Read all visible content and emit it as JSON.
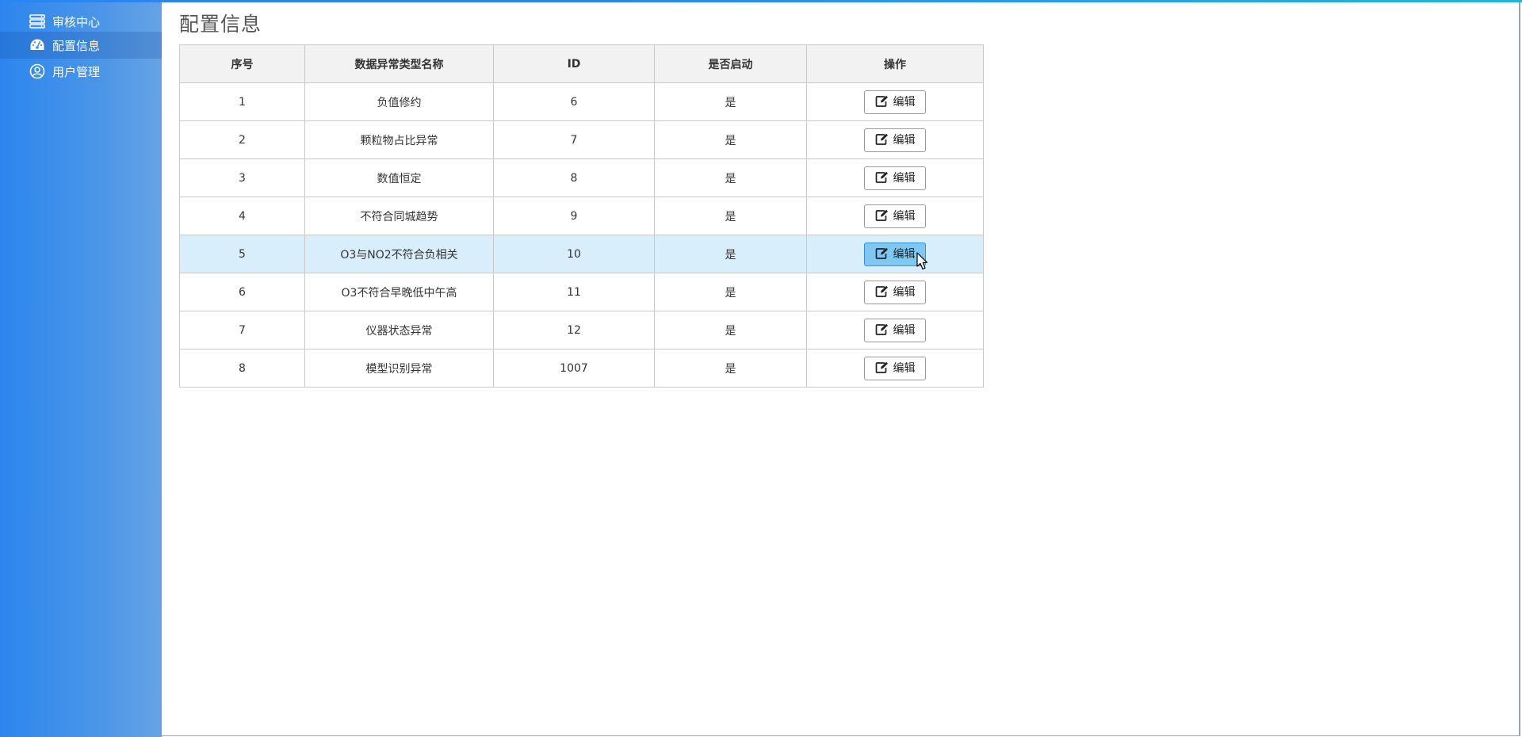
{
  "sidebar": {
    "items": [
      {
        "label": "审核中心",
        "icon": "server-list-icon",
        "active": false
      },
      {
        "label": "配置信息",
        "icon": "dashboard-gauge-icon",
        "active": true
      },
      {
        "label": "用户管理",
        "icon": "user-circle-icon",
        "active": false
      }
    ]
  },
  "page": {
    "title": "配置信息"
  },
  "table": {
    "headers": [
      "序号",
      "数据异常类型名称",
      "ID",
      "是否启动",
      "操作"
    ],
    "rows": [
      {
        "index": "1",
        "name": "负值修约",
        "id": "6",
        "enabled": "是",
        "action": "编辑"
      },
      {
        "index": "2",
        "name": "颗粒物占比异常",
        "id": "7",
        "enabled": "是",
        "action": "编辑"
      },
      {
        "index": "3",
        "name": "数值恒定",
        "id": "8",
        "enabled": "是",
        "action": "编辑"
      },
      {
        "index": "4",
        "name": "不符合同城趋势",
        "id": "9",
        "enabled": "是",
        "action": "编辑"
      },
      {
        "index": "5",
        "name": "O3与NO2不符合负相关",
        "id": "10",
        "enabled": "是",
        "action": "编辑"
      },
      {
        "index": "6",
        "name": "O3不符合早晚低中午高",
        "id": "11",
        "enabled": "是",
        "action": "编辑"
      },
      {
        "index": "7",
        "name": "仪器状态异常",
        "id": "12",
        "enabled": "是",
        "action": "编辑"
      },
      {
        "index": "8",
        "name": "模型识别异常",
        "id": "1007",
        "enabled": "是",
        "action": "编辑"
      }
    ],
    "hovered_row": 5
  },
  "colors": {
    "sidebar_start": "#2c86ee",
    "sidebar_end": "#66a3e4",
    "row_highlight": "#d8eefa",
    "button_hover": "#7ec8f4"
  }
}
